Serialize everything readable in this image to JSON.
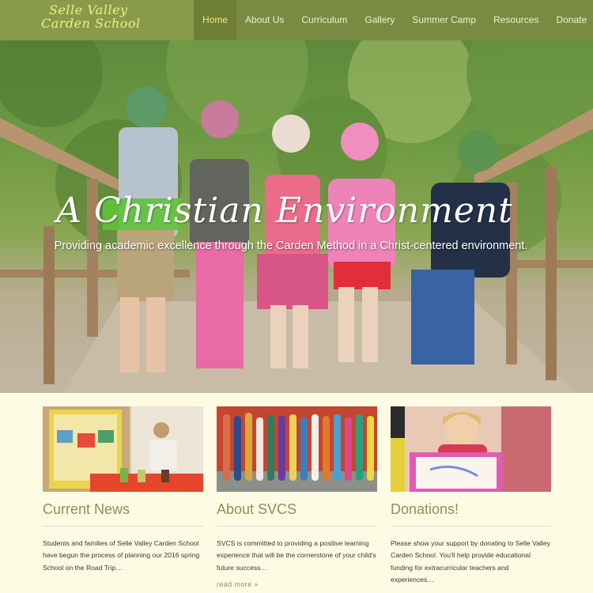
{
  "logo": {
    "line1": "Selle Valley",
    "line2": "Carden School"
  },
  "nav": {
    "items": [
      {
        "label": "Home",
        "active": true
      },
      {
        "label": "About Us"
      },
      {
        "label": "Curriculum"
      },
      {
        "label": "Gallery"
      },
      {
        "label": "Summer Camp"
      },
      {
        "label": "Resources"
      },
      {
        "label": "Donate"
      }
    ]
  },
  "hero": {
    "title": "A Christian Environment",
    "subtitle": "Providing academic excellence through the Carden Method in a Christ-centered environment."
  },
  "cards": [
    {
      "title": "Current News",
      "text": "Students and families of Selle Valley Carden School have begun the process of planning our 2016 spring School on the Road Trip…"
    },
    {
      "title": "About SVCS",
      "text": "SVCS is committed to providing a positive learning experience that will be the cornerstone of your child's future success…",
      "more": "read more »"
    },
    {
      "title": "Donations!",
      "text": "Please show your support by donating to Selle Valley Carden School. You'll help provide educational funding for extracurricular teachers and experiences…"
    }
  ],
  "colors": {
    "nav_bg": "#7a8a41",
    "logo_bg": "#8a9a4b",
    "active_text": "#f4ec6c",
    "page_bg": "#fdfbe4",
    "accent": "#8c9257"
  }
}
